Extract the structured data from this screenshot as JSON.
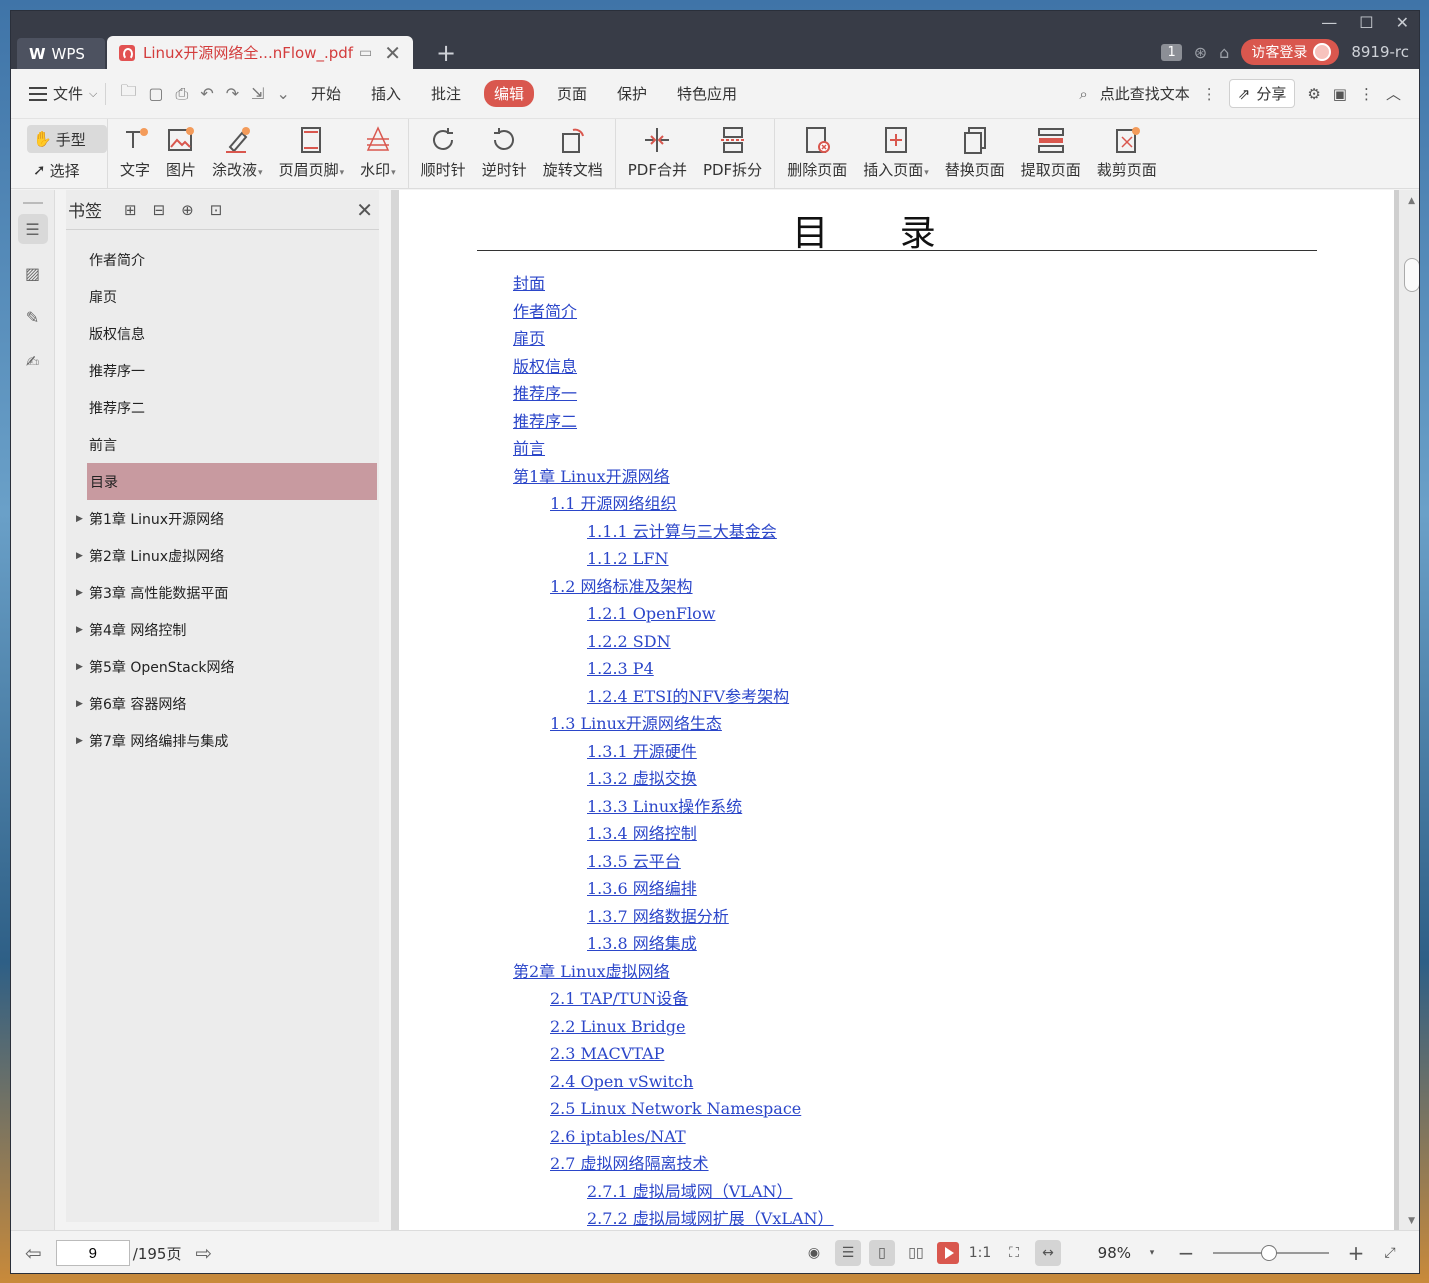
{
  "titlebar": {
    "app_tab": "WPS",
    "doc_tab": "Linux开源网络全...nFlow_.pdf",
    "page_badge": "1",
    "login": "访客登录",
    "user_id": "8919-rc"
  },
  "menu": {
    "file": "文件",
    "items": [
      "开始",
      "插入",
      "批注",
      "编辑",
      "页面",
      "保护",
      "特色应用"
    ],
    "active": "编辑",
    "search_placeholder": "点此查找文本",
    "share": "分享"
  },
  "ribbon": {
    "hand": "手型",
    "select": "选择",
    "buttons": [
      "文字",
      "图片",
      "涂改液",
      "页眉页脚",
      "水印",
      "顺时针",
      "逆时针",
      "旋转文档",
      "PDF合并",
      "PDF拆分",
      "删除页面",
      "插入页面",
      "替换页面",
      "提取页面",
      "裁剪页面"
    ]
  },
  "bookmarks": {
    "title": "书签",
    "items": [
      "作者简介",
      "扉页",
      "版权信息",
      "推荐序一",
      "推荐序二",
      "前言",
      "目录",
      "第1章 Linux开源网络",
      "第2章 Linux虚拟网络",
      "第3章 高性能数据平面",
      "第4章 网络控制",
      "第5章 OpenStack网络",
      "第6章 容器网络",
      "第7章 网络编排与集成"
    ],
    "selected": "目录"
  },
  "document": {
    "title": "目 录",
    "toc": [
      {
        "text": "封面",
        "level": 0
      },
      {
        "text": "作者简介",
        "level": 0
      },
      {
        "text": "扉页",
        "level": 0
      },
      {
        "text": "版权信息",
        "level": 0
      },
      {
        "text": "推荐序一",
        "level": 0
      },
      {
        "text": "推荐序二",
        "level": 0
      },
      {
        "text": "前言",
        "level": 0
      },
      {
        "text": "第1章 Linux开源网络",
        "level": 0
      },
      {
        "text": "1.1 开源网络组织",
        "level": 1
      },
      {
        "text": "1.1.1 云计算与三大基金会",
        "level": 2
      },
      {
        "text": "1.1.2 LFN",
        "level": 2
      },
      {
        "text": "1.2 网络标准及架构",
        "level": 1
      },
      {
        "text": "1.2.1 OpenFlow",
        "level": 2
      },
      {
        "text": "1.2.2 SDN",
        "level": 2
      },
      {
        "text": "1.2.3 P4",
        "level": 2
      },
      {
        "text": "1.2.4 ETSI的NFV参考架构",
        "level": 2
      },
      {
        "text": "1.3 Linux开源网络生态",
        "level": 1
      },
      {
        "text": "1.3.1 开源硬件",
        "level": 2
      },
      {
        "text": "1.3.2 虚拟交换",
        "level": 2
      },
      {
        "text": "1.3.3 Linux操作系统",
        "level": 2
      },
      {
        "text": "1.3.4 网络控制",
        "level": 2
      },
      {
        "text": "1.3.5 云平台",
        "level": 2
      },
      {
        "text": "1.3.6 网络编排",
        "level": 2
      },
      {
        "text": "1.3.7 网络数据分析",
        "level": 2
      },
      {
        "text": "1.3.8 网络集成",
        "level": 2
      },
      {
        "text": "第2章 Linux虚拟网络",
        "level": 0
      },
      {
        "text": "2.1 TAP/TUN设备",
        "level": 1
      },
      {
        "text": "2.2 Linux Bridge",
        "level": 1
      },
      {
        "text": "2.3 MACVTAP",
        "level": 1
      },
      {
        "text": "2.4 Open vSwitch",
        "level": 1
      },
      {
        "text": "2.5 Linux Network Namespace",
        "level": 1
      },
      {
        "text": "2.6 iptables/NAT",
        "level": 1
      },
      {
        "text": "2.7 虚拟网络隔离技术",
        "level": 1
      },
      {
        "text": "2.7.1 虚拟局域网（VLAN）",
        "level": 2
      },
      {
        "text": "2.7.2 虚拟局域网扩展（VxLAN）",
        "level": 2
      }
    ]
  },
  "status": {
    "page_value": "9",
    "page_total": "/195页",
    "zoom": "98%"
  }
}
